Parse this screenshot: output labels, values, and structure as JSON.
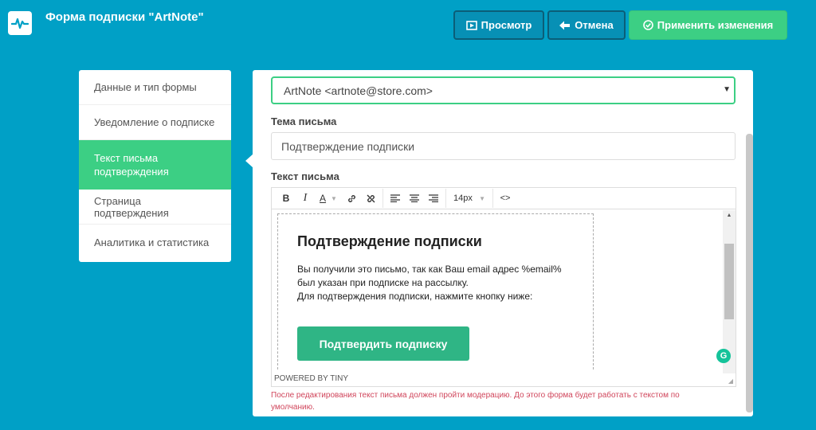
{
  "header": {
    "title": "Форма подписки \"ArtNote\"",
    "preview_label": "Просмотр",
    "cancel_label": "Отмена",
    "apply_label": "Применить изменения"
  },
  "sidebar": {
    "items": [
      {
        "label": "Данные и тип формы"
      },
      {
        "label": "Уведомление о подписке"
      },
      {
        "label": "Текст письма подтверждения"
      },
      {
        "label": "Страница подтверждения"
      },
      {
        "label": "Аналитика и статистика"
      }
    ]
  },
  "form": {
    "sender": "ArtNote <artnote@store.com>",
    "subject_label": "Тема письма",
    "subject_value": "Подтверждение подписки",
    "body_label": "Текст письма",
    "font_size": "14px"
  },
  "email": {
    "title": "Подтверждение подписки",
    "line1": "Вы получили это письмо, так как Ваш email адрес %email%",
    "line2": "был указан при подписке на рассылку.",
    "line3": "Для подтверждения подписки, нажмите кнопку ниже:",
    "button_label": "Подтвердить подписку"
  },
  "editor": {
    "powered_by": "POWERED BY TINY"
  },
  "note": "После редактирования текст письма должен пройти модерацию. До этого форма будет работать с текстом по умолчанию.",
  "colors": {
    "background": "#00a0c6",
    "accent": "#3ccf84",
    "email_button": "#2fb585",
    "warning": "#d0455b"
  }
}
